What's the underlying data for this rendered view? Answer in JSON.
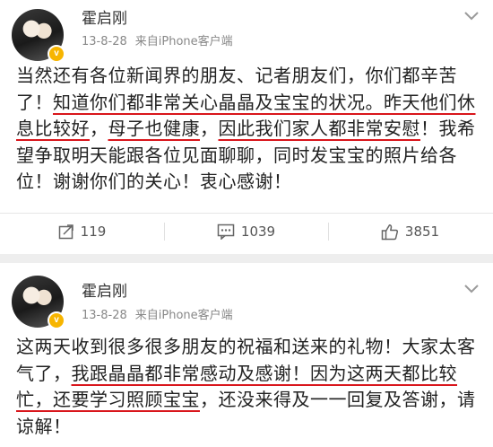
{
  "posts": [
    {
      "author": "霍启刚",
      "date": "13-8-28",
      "source": "来自iPhone客户端",
      "badge": "v",
      "text": {
        "a": "当然还有各位新闻界的朋友、记者朋友们，你们都辛苦了！",
        "b": "知道你们都非常关心晶晶及宝宝的状况。",
        "c": "昨天他们休息比较好",
        "d": "，",
        "e": "母子也健康",
        "f": "，",
        "g": "因此我们家人都非常安慰",
        "h": "！我希望争取明天能跟各位见面聊聊，同时发宝宝的照片给各位！谢谢你们的关心！衷心感谢！"
      },
      "reposts": "119",
      "comments": "1039",
      "likes": "3851"
    },
    {
      "author": "霍启刚",
      "date": "13-8-28",
      "source": "来自iPhone客户端",
      "badge": "v",
      "text": {
        "a": "这两天收到很多很多朋友的祝福和送来的礼物！大家太客气了，",
        "b": "我跟晶晶都非常感动及感谢！",
        "c": "因为这两天都比较忙，",
        "d": "还要学习照顾宝宝",
        "e": "，还没来得及一一回复及答谢，请谅解！"
      }
    }
  ],
  "colors": {
    "underline": "#d9161c",
    "badge": "#f7b500"
  }
}
